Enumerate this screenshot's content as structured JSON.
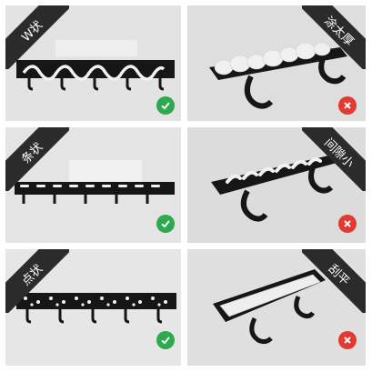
{
  "panels": [
    {
      "label": "W状",
      "verdict": "correct"
    },
    {
      "label": "涂太厚",
      "verdict": "wrong"
    },
    {
      "label": "条状",
      "verdict": "correct"
    },
    {
      "label": "间隙小",
      "verdict": "wrong"
    },
    {
      "label": "点状",
      "verdict": "correct"
    },
    {
      "label": "刮平",
      "verdict": "wrong"
    }
  ],
  "colors": {
    "banner": "#2b2b2b",
    "correct": "#2fa84f",
    "wrong": "#e23a30",
    "rack": "#151515",
    "glue": "#f2f2f2"
  }
}
